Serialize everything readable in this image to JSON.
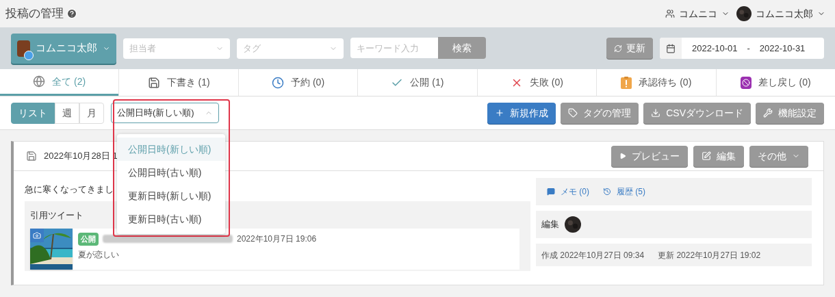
{
  "header": {
    "title": "投稿の管理",
    "team": "コムニコ",
    "user": "コムニコ太郎"
  },
  "toolbar": {
    "account": "コムニコ太郎",
    "assignee_placeholder": "担当者",
    "tag_placeholder": "タグ",
    "keyword_placeholder": "キーワード入力",
    "search_button": "検索",
    "refresh_button": "更新",
    "date_from": "2022-10-01",
    "date_separator": "-",
    "date_to": "2022-10-31"
  },
  "tabs": [
    {
      "kind": "all",
      "label": "全て (2)",
      "selected": true
    },
    {
      "kind": "draft",
      "label": "下書き (1)",
      "selected": false
    },
    {
      "kind": "scheduled",
      "label": "予約 (0)",
      "selected": false
    },
    {
      "kind": "published",
      "label": "公開 (1)",
      "selected": false
    },
    {
      "kind": "failed",
      "label": "失敗 (0)",
      "selected": false
    },
    {
      "kind": "pending",
      "label": "承認待ち (0)",
      "selected": false
    },
    {
      "kind": "returned",
      "label": "差し戻し (0)",
      "selected": false
    }
  ],
  "views": [
    {
      "label": "リスト",
      "selected": true
    },
    {
      "label": "週",
      "selected": false
    },
    {
      "label": "月",
      "selected": false
    }
  ],
  "sort": {
    "value": "公開日時(新しい順)",
    "expanded": true,
    "options": [
      {
        "label": "公開日時(新しい順)",
        "selected": true
      },
      {
        "label": "公開日時(古い順)",
        "selected": false
      },
      {
        "label": "更新日時(新しい順)",
        "selected": false
      },
      {
        "label": "更新日時(古い順)",
        "selected": false
      }
    ]
  },
  "actions": [
    {
      "kind": "new",
      "label": "新規作成"
    },
    {
      "kind": "tags",
      "label": "タグの管理"
    },
    {
      "kind": "csv",
      "label": "CSVダウンロード"
    },
    {
      "kind": "settings",
      "label": "機能設定"
    }
  ],
  "post": {
    "date": "2022年10月28日 1",
    "buttons": [
      {
        "kind": "preview",
        "label": "プレビュー"
      },
      {
        "kind": "edit",
        "label": "編集"
      },
      {
        "kind": "more",
        "label": "その他"
      }
    ],
    "text": "急に寒くなってきまし",
    "quote": {
      "heading": "引用ツイート",
      "badge": "公開",
      "time": "2022年10月7日 19:06",
      "text": "夏が恋しい"
    },
    "memo": "メモ (0)",
    "history": "履歴 (5)",
    "editor_label": "編集",
    "created": "作成 2022年10月27日 09:34",
    "updated": "更新 2022年10月27日 19:02"
  }
}
